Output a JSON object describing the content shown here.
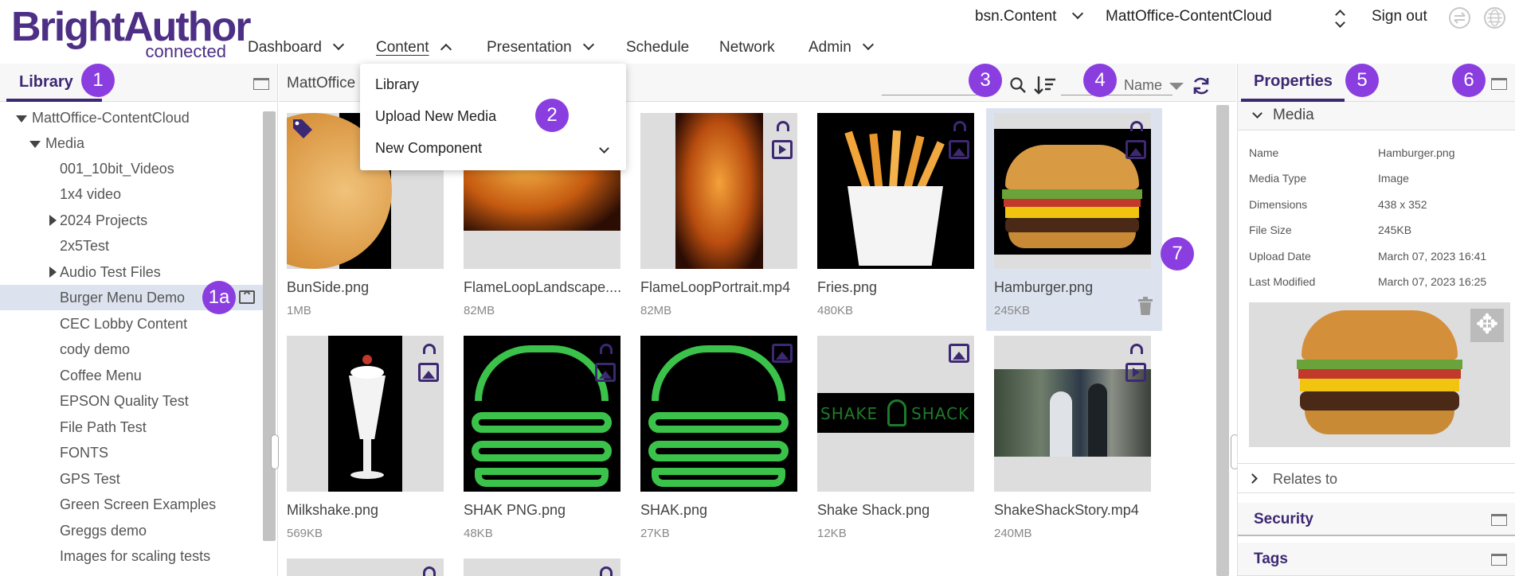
{
  "app": {
    "logo_main": "BrightAuthor",
    "logo_sub": "connected",
    "account": "bsn.Content",
    "network": "MattOffice-ContentCloud",
    "sign_out": "Sign out"
  },
  "nav": {
    "items": [
      {
        "label": "Dashboard"
      },
      {
        "label": "Content"
      },
      {
        "label": "Presentation"
      },
      {
        "label": "Schedule"
      },
      {
        "label": "Network"
      },
      {
        "label": "Admin"
      }
    ]
  },
  "content_menu": {
    "items": [
      "Library",
      "Upload New Media",
      "New Component"
    ]
  },
  "library": {
    "tab": "Library",
    "tree": [
      {
        "label": "MattOffice-ContentCloud"
      },
      {
        "label": "Media"
      },
      {
        "label": "001_10bit_Videos"
      },
      {
        "label": "1x4 video"
      },
      {
        "label": "2024 Projects"
      },
      {
        "label": "2x5Test"
      },
      {
        "label": "Audio Test Files"
      },
      {
        "label": "Burger Menu Demo"
      },
      {
        "label": "CEC Lobby Content"
      },
      {
        "label": "cody demo"
      },
      {
        "label": "Coffee Menu"
      },
      {
        "label": "EPSON Quality Test"
      },
      {
        "label": "File Path Test"
      },
      {
        "label": "FONTS"
      },
      {
        "label": "GPS Test"
      },
      {
        "label": "Green Screen Examples"
      },
      {
        "label": "Greggs demo"
      },
      {
        "label": "Images for scaling tests"
      }
    ]
  },
  "center": {
    "path": "MattOffice",
    "sort_label": "Name"
  },
  "media": [
    {
      "name": "BunSide.png",
      "size": "1MB"
    },
    {
      "name": "FlameLoopLandscape....",
      "size": "82MB"
    },
    {
      "name": "FlameLoopPortrait.mp4",
      "size": "82MB"
    },
    {
      "name": "Fries.png",
      "size": "480KB"
    },
    {
      "name": "Hamburger.png",
      "size": "245KB"
    },
    {
      "name": "Milkshake.png",
      "size": "569KB"
    },
    {
      "name": "SHAK PNG.png",
      "size": "48KB"
    },
    {
      "name": "SHAK.png",
      "size": "27KB"
    },
    {
      "name": "Shake Shack.png",
      "size": "12KB"
    },
    {
      "name": "ShakeShackStory.mp4",
      "size": "240MB"
    }
  ],
  "shake_text": {
    "left": "SHAKE",
    "right": "SHACK"
  },
  "properties": {
    "tab": "Properties",
    "media_section": "Media",
    "rows": [
      {
        "key": "Name",
        "value": "Hamburger.png"
      },
      {
        "key": "Media Type",
        "value": "Image"
      },
      {
        "key": "Dimensions",
        "value": "438 x 352"
      },
      {
        "key": "File Size",
        "value": "245KB"
      },
      {
        "key": "Upload Date",
        "value": "March 07, 2023 16:41"
      },
      {
        "key": "Last Modified",
        "value": "March 07, 2023 16:25"
      }
    ],
    "relates_to": "Relates to",
    "security": "Security",
    "tags": "Tags"
  },
  "badges": [
    "1",
    "1a",
    "2",
    "3",
    "4",
    "5",
    "6",
    "7"
  ],
  "colors": {
    "brand": "#4d2f85",
    "badge": "#8a3ee0",
    "selected_bg": "#dde3ee",
    "icon": "#3d2873"
  }
}
